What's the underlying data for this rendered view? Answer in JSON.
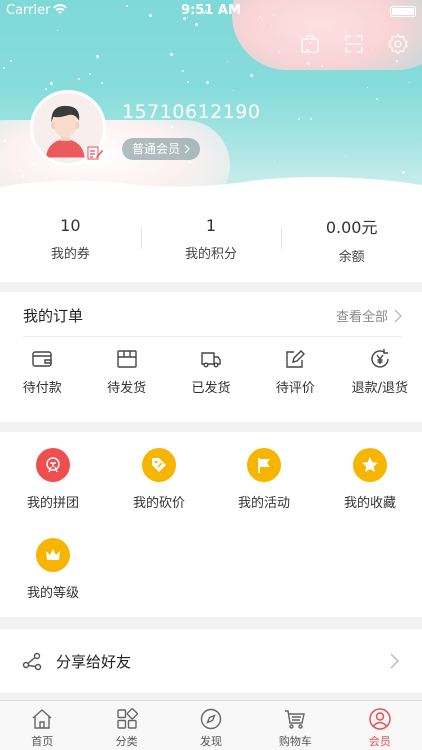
{
  "status_bar": {
    "carrier": "Carrier",
    "time": "9:51 AM"
  },
  "profile": {
    "phone": "15710612190",
    "member_level": "普通会员"
  },
  "stats": [
    {
      "value": "10",
      "label": "我的券"
    },
    {
      "value": "1",
      "label": "我的积分"
    },
    {
      "value": "0.00元",
      "label": "余额"
    }
  ],
  "orders": {
    "title": "我的订单",
    "view_all": "查看全部",
    "items": [
      {
        "label": "待付款",
        "icon": "wallet-icon"
      },
      {
        "label": "待发货",
        "icon": "box-icon"
      },
      {
        "label": "已发货",
        "icon": "truck-icon"
      },
      {
        "label": "待评价",
        "icon": "edit-icon"
      },
      {
        "label": "退款/退货",
        "icon": "yen-refund-icon"
      }
    ]
  },
  "features": [
    {
      "label": "我的拼团",
      "icon": "group-buy-icon",
      "color": "#f04e4e"
    },
    {
      "label": "我的砍价",
      "icon": "tag-icon",
      "color": "#f7b500"
    },
    {
      "label": "我的活动",
      "icon": "flag-icon",
      "color": "#f7b500"
    },
    {
      "label": "我的收藏",
      "icon": "star-icon",
      "color": "#f7b500"
    },
    {
      "label": "我的等级",
      "icon": "crown-icon",
      "color": "#f7b500"
    }
  ],
  "share": {
    "label": "分享给好友"
  },
  "tabs": [
    {
      "label": "首页",
      "icon": "home-icon",
      "active": false
    },
    {
      "label": "分类",
      "icon": "category-icon",
      "active": false
    },
    {
      "label": "发现",
      "icon": "compass-icon",
      "active": false
    },
    {
      "label": "购物车",
      "icon": "cart-icon",
      "active": false
    },
    {
      "label": "会员",
      "icon": "user-icon",
      "active": true
    }
  ],
  "colors": {
    "accent": "#e94e5e",
    "header": "#86dcdb",
    "yellow": "#f7b500",
    "red": "#f04e4e"
  }
}
